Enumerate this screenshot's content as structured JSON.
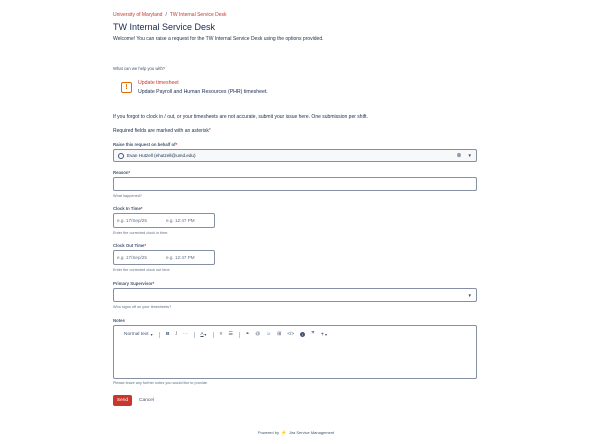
{
  "breadcrumb": {
    "items": [
      "University of Maryland",
      "TW Internal Service Desk"
    ],
    "separator": "/"
  },
  "page": {
    "title": "TW Internal Service Desk",
    "welcome": "Welcome! You can raise a request for the TW Internal Service Desk using the options provided."
  },
  "request_type": {
    "question": "What can we help you with?",
    "name": "Update timesheet",
    "description": "Update Payroll and Human Resources (PHR) timesheet.",
    "icon": "exclamation-icon"
  },
  "info_text": "If you forgot to clock in / out, or your timesheets are not accurate, submit your issue here. One submission per shift.",
  "required_note": "Required fields are marked with an asterisk",
  "asterisk": "*",
  "fields": {
    "on_behalf": {
      "label": "Raise this request on behalf of",
      "value": "Evan Hutzell (ehutzell@umd.edu)"
    },
    "reason": {
      "label": "Reason",
      "helper": "What happened?"
    },
    "clock_in": {
      "label": "Clock In Time",
      "date_placeholder": "e.g. 17/Sep/25",
      "time_placeholder": "e.g. 12:47 PM",
      "helper": "Enter the corrected clock in time."
    },
    "clock_out": {
      "label": "Clock Out Time",
      "date_placeholder": "e.g. 17/Sep/25",
      "time_placeholder": "e.g. 12:47 PM",
      "helper": "Enter the corrected clock out time."
    },
    "supervisor": {
      "label": "Primary Supervisor",
      "helper": "Who signs off on your timesheets?"
    },
    "notes": {
      "label": "Notes",
      "helper": "Please leave any further notes you would like to provide."
    }
  },
  "editor_toolbar": {
    "text_style": "Normal text",
    "bold": "B",
    "italic": "I",
    "more": "···",
    "text_color": "A",
    "bullet_list": "≡",
    "numbered_list": "☰",
    "link": "⚭",
    "mention": "@",
    "emoji": "☺",
    "table": "⊞",
    "code": "</>",
    "info": "i",
    "quote": "”",
    "insert": "+"
  },
  "actions": {
    "send": "Send",
    "cancel": "Cancel"
  },
  "footer": {
    "prefix": "Powered by",
    "product": "Jira Service Management"
  },
  "colors": {
    "accent": "#c9372c",
    "warning": "#e06c00",
    "text": "#172b4d",
    "subtle": "#44546f"
  }
}
